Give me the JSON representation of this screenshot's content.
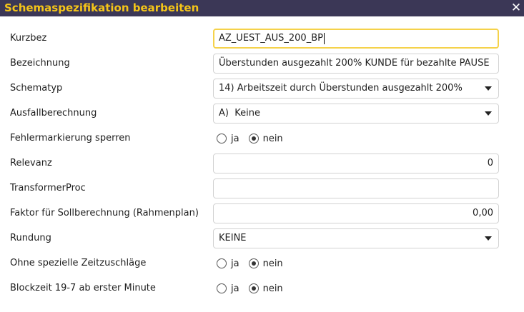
{
  "dialog": {
    "title": "Schemaspezifikation bearbeiten",
    "close_icon": "close-icon"
  },
  "fields": {
    "kurzbez": {
      "label": "Kurzbez",
      "value": "AZ_UEST_AUS_200_BP"
    },
    "bezeichnung": {
      "label": "Bezeichnung",
      "value": "Überstunden ausgezahlt 200% KUNDE für bezahlte PAUSE"
    },
    "schematyp": {
      "label": "Schematyp",
      "value": "14) Arbeitszeit durch Überstunden ausgezahlt 200%"
    },
    "ausfallberechnung": {
      "label": "Ausfallberechnung",
      "value": "A)  Keine"
    },
    "fehlermarkierung": {
      "label": "Fehlermarkierung sperren",
      "option_ja": "ja",
      "option_nein": "nein",
      "selected": "nein"
    },
    "relevanz": {
      "label": "Relevanz",
      "value": "0"
    },
    "transformerproc": {
      "label": "TransformerProc",
      "value": ""
    },
    "faktor": {
      "label": "Faktor für Sollberechnung (Rahmenplan)",
      "value": "0,00"
    },
    "rundung": {
      "label": "Rundung",
      "value": "KEINE"
    },
    "zeitzuschlaege": {
      "label": "Ohne spezielle Zeitzuschläge",
      "option_ja": "ja",
      "option_nein": "nein",
      "selected": "nein"
    },
    "blockzeit": {
      "label": "Blockzeit 19-7 ab erster Minute",
      "option_ja": "ja",
      "option_nein": "nein",
      "selected": "nein"
    }
  },
  "colors": {
    "titlebar_bg": "#3b3756",
    "title_text": "#f5c518",
    "focus_border": "#f5d24a"
  }
}
